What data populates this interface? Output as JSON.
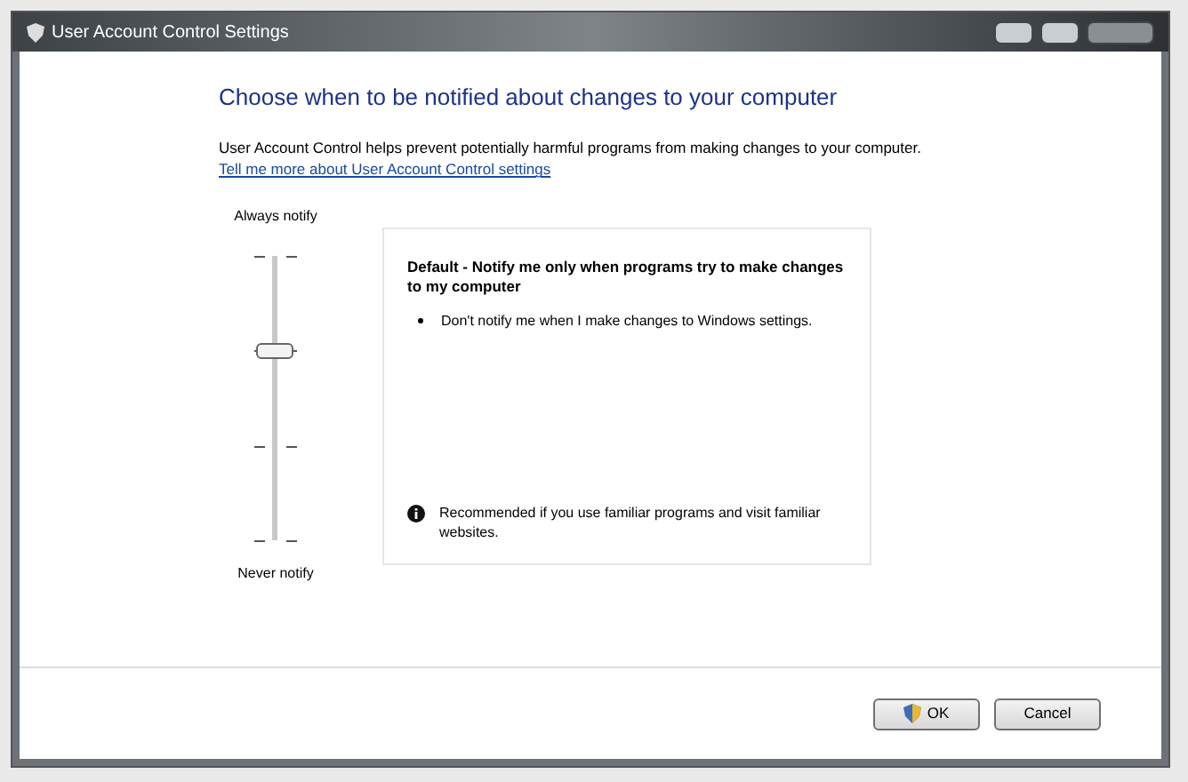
{
  "window": {
    "title": "User Account Control Settings"
  },
  "heading": "Choose when to be notified about changes to your computer",
  "intro": "User Account Control helps prevent potentially harmful programs from making changes to your computer.",
  "help_link": "Tell me more about User Account Control settings",
  "slider": {
    "top_label": "Always notify",
    "bottom_label": "Never notify",
    "level": 0.67
  },
  "description": {
    "title": "Default - Notify me only when programs try to make changes to my computer",
    "bullets": [
      "Don't notify me when I make changes to Windows settings."
    ],
    "recommendation": "Recommended if you use familiar programs and visit familiar websites."
  },
  "buttons": [
    {
      "label": "OK",
      "kind": "shield"
    },
    {
      "label": "Cancel",
      "kind": "plain"
    }
  ]
}
